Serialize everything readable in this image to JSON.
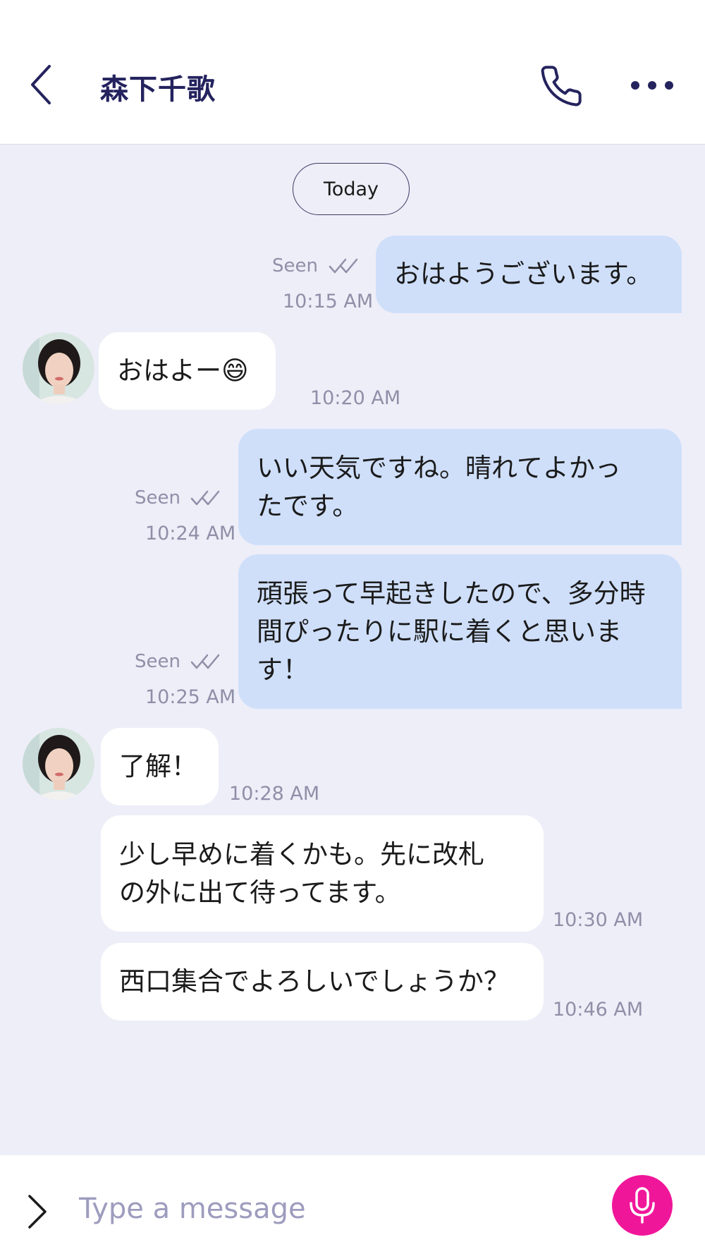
{
  "header": {
    "title": "森下千歌",
    "back_icon": "chevron-left-icon",
    "call_icon": "phone-icon",
    "more_icon": "more-horizontal-icon"
  },
  "day_divider": "Today",
  "messages": [
    {
      "direction": "out",
      "text": "おはようございます。",
      "status": "Seen",
      "time": "10:15 AM"
    },
    {
      "direction": "in",
      "text": "おはよー😄",
      "time": "10:20 AM"
    },
    {
      "direction": "out",
      "text": "いい天気ですね。晴れてよかったです。",
      "lines": [
        "いい天気ですね。晴れてよかっ",
        "たです。"
      ],
      "status": "Seen",
      "time": "10:24 AM"
    },
    {
      "direction": "out",
      "text": "頑張って早起きしたので、多分時間ぴったりに駅に着くと思います！",
      "lines": [
        "頑張って早起きしたので、多分時",
        "間ぴったりに駅に着くと思いま",
        "す！"
      ],
      "status": "Seen",
      "time": "10:25 AM"
    },
    {
      "direction": "in",
      "text": "了解！",
      "time": "10:28 AM"
    },
    {
      "direction": "in",
      "text": "少し早めに着くかも。先に改札の外に出て待ってます。",
      "lines": [
        "少し早めに着くかも。先に改札",
        "の外に出て待ってます。"
      ],
      "time": "10:30 AM"
    },
    {
      "direction": "in",
      "text": "西口集合でよろしいでしょうか？",
      "time": "10:46 AM"
    }
  ],
  "composer": {
    "placeholder": "Type a message",
    "expand_icon": "chevron-right-icon",
    "mic_icon": "microphone-icon"
  },
  "colors": {
    "accent": "#f0169a",
    "title": "#24235e",
    "outgoing_bubble": "#cfdffa",
    "incoming_bubble": "#ffffff",
    "background": "#eeeef8",
    "meta_text": "#8f8fa8"
  }
}
